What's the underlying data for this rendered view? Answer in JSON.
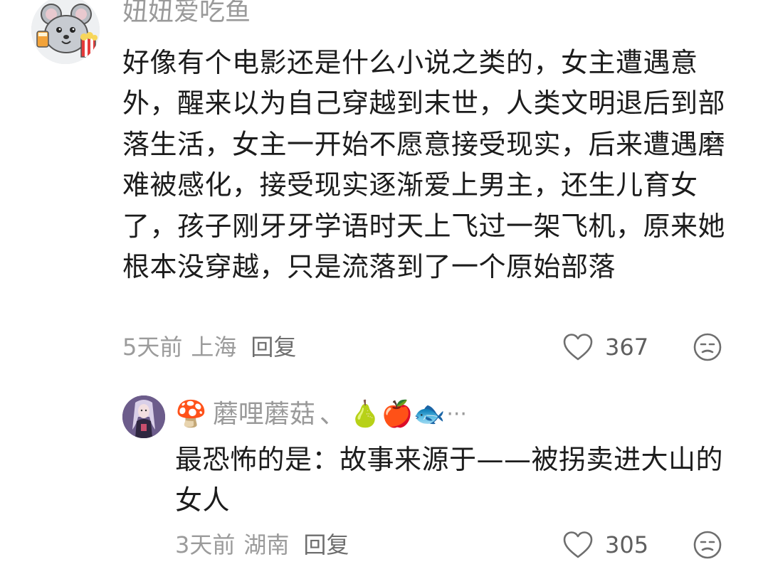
{
  "comments": [
    {
      "username": "妞妞爱吃鱼",
      "avatar_icon": "cartoon-mouse-avatar",
      "text": "好像有个电影还是什么小说之类的，女主遭遇意外，醒来以为自己穿越到末世，人类文明退后到部落生活，女主一开始不愿意接受现实，后来遭遇磨难被感化，接受现实逐渐爱上男主，还生儿育女了，孩子刚牙牙学语时天上飞过一架飞机，原来她根本没穿越，只是流落到了一个原始部落",
      "time": "5天前",
      "region": "上海",
      "reply_label": "回复",
      "likes": "367"
    },
    {
      "username": "蘑哩蘑菇",
      "name_prefix_emoji": "🍄",
      "separator": "、",
      "name_suffix_emojis": [
        "🍐",
        "🍎",
        "🐟"
      ],
      "name_ellipsis": "···",
      "avatar_icon": "anime-character-avatar",
      "text": "最恐怖的是：故事来源于——被拐卖进大山的女人",
      "time": "3天前",
      "region": "湖南",
      "reply_label": "回复",
      "likes": "305"
    }
  ],
  "colors": {
    "text_primary": "#1c1c1c",
    "text_secondary": "#9b9b9b",
    "icon_gray": "#6e6e6e"
  }
}
